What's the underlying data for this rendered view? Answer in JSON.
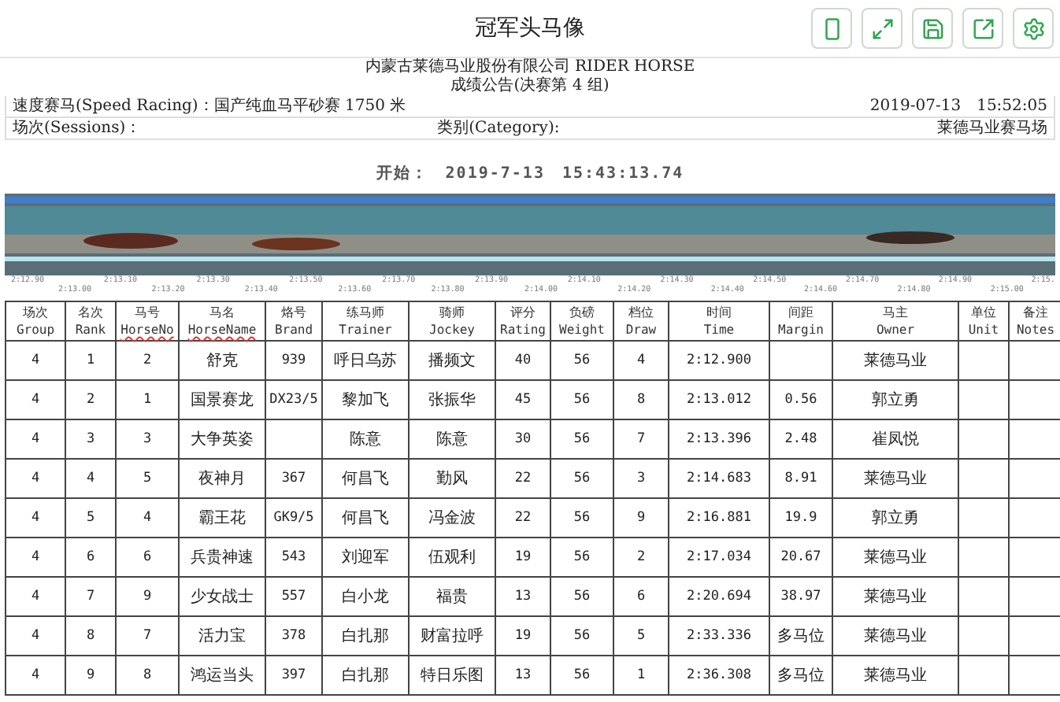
{
  "window": {
    "title": "冠军头马像"
  },
  "toolbar": [
    {
      "kind": "portrait"
    },
    {
      "kind": "expand"
    },
    {
      "kind": "save"
    },
    {
      "kind": "share"
    },
    {
      "kind": "settings"
    }
  ],
  "report": {
    "company": "内蒙古莱德马业股份有限公司 RIDER HORSE",
    "heading": "成绩公告(决赛第 4 组)",
    "race": "速度赛马(Speed Racing)：国产纯血马平砂赛 1750 米",
    "datetime": "2019-07-13　15:52:05",
    "sessions": "场次(Sessions)：",
    "category": "类别(Category):",
    "venue": "莱德马业赛马场",
    "start": "开始：　2019-7-13　15:43:13.74",
    "ticks_upper": [
      "2:12.90",
      "2:13.10",
      "2:13.30",
      "2:13.50",
      "2:13.70",
      "2:13.90",
      "2:14.10",
      "2:14.30",
      "2:14.50",
      "2:14.70",
      "2:14.90",
      "2:15."
    ],
    "ticks_lower": [
      "2:13.00",
      "2:13.20",
      "2:13.40",
      "2:13.60",
      "2:13.80",
      "2:14.00",
      "2:14.20",
      "2:14.40",
      "2:14.60",
      "2:14.80",
      "2:15.00"
    ]
  },
  "table": {
    "columns": [
      {
        "zh": "场次",
        "en": "Group"
      },
      {
        "zh": "名次",
        "en": "Rank"
      },
      {
        "zh": "马号",
        "en": "HorseNo",
        "spellcheck": true
      },
      {
        "zh": "马名",
        "en": "HorseName",
        "spellcheck": true
      },
      {
        "zh": "烙号",
        "en": "Brand"
      },
      {
        "zh": "练马师",
        "en": "Trainer"
      },
      {
        "zh": "骑师",
        "en": "Jockey"
      },
      {
        "zh": "评分",
        "en": "Rating"
      },
      {
        "zh": "负磅",
        "en": "Weight"
      },
      {
        "zh": "档位",
        "en": "Draw"
      },
      {
        "zh": "时间",
        "en": "Time"
      },
      {
        "zh": "间距",
        "en": "Margin"
      },
      {
        "zh": "马主",
        "en": "Owner"
      },
      {
        "zh": "单位",
        "en": "Unit"
      },
      {
        "zh": "备注",
        "en": "Notes"
      }
    ],
    "rows": [
      [
        "4",
        "1",
        "2",
        "舒克",
        "939",
        "呼日乌苏",
        "播频文",
        "40",
        "56",
        "4",
        "2:12.900",
        "",
        "莱德马业",
        "",
        ""
      ],
      [
        "4",
        "2",
        "1",
        "国景赛龙",
        "DX23/5",
        "黎加飞",
        "张振华",
        "45",
        "56",
        "8",
        "2:13.012",
        "0.56",
        "郭立勇",
        "",
        ""
      ],
      [
        "4",
        "3",
        "3",
        "大争英姿",
        "",
        "陈意",
        "陈意",
        "30",
        "56",
        "7",
        "2:13.396",
        "2.48",
        "崔凤悦",
        "",
        ""
      ],
      [
        "4",
        "4",
        "5",
        "夜神月",
        "367",
        "何昌飞",
        "勤风",
        "22",
        "56",
        "3",
        "2:14.683",
        "8.91",
        "莱德马业",
        "",
        ""
      ],
      [
        "4",
        "5",
        "4",
        "霸王花",
        "GK9/5",
        "何昌飞",
        "冯金波",
        "22",
        "56",
        "9",
        "2:16.881",
        "19.9",
        "郭立勇",
        "",
        ""
      ],
      [
        "4",
        "6",
        "6",
        "兵贵神速",
        "543",
        "刘迎军",
        "伍观利",
        "19",
        "56",
        "2",
        "2:17.034",
        "20.67",
        "莱德马业",
        "",
        ""
      ],
      [
        "4",
        "7",
        "9",
        "少女战士",
        "557",
        "白小龙",
        "福贵",
        "13",
        "56",
        "6",
        "2:20.694",
        "38.97",
        "莱德马业",
        "",
        ""
      ],
      [
        "4",
        "8",
        "7",
        "活力宝",
        "378",
        "白扎那",
        "财富拉呼",
        "19",
        "56",
        "5",
        "2:33.336",
        "多马位",
        "莱德马业",
        "",
        ""
      ],
      [
        "4",
        "9",
        "8",
        "鸿运当头",
        "397",
        "白扎那",
        "特日乐图",
        "13",
        "56",
        "1",
        "2:36.308",
        "多马位",
        "莱德马业",
        "",
        ""
      ]
    ]
  }
}
